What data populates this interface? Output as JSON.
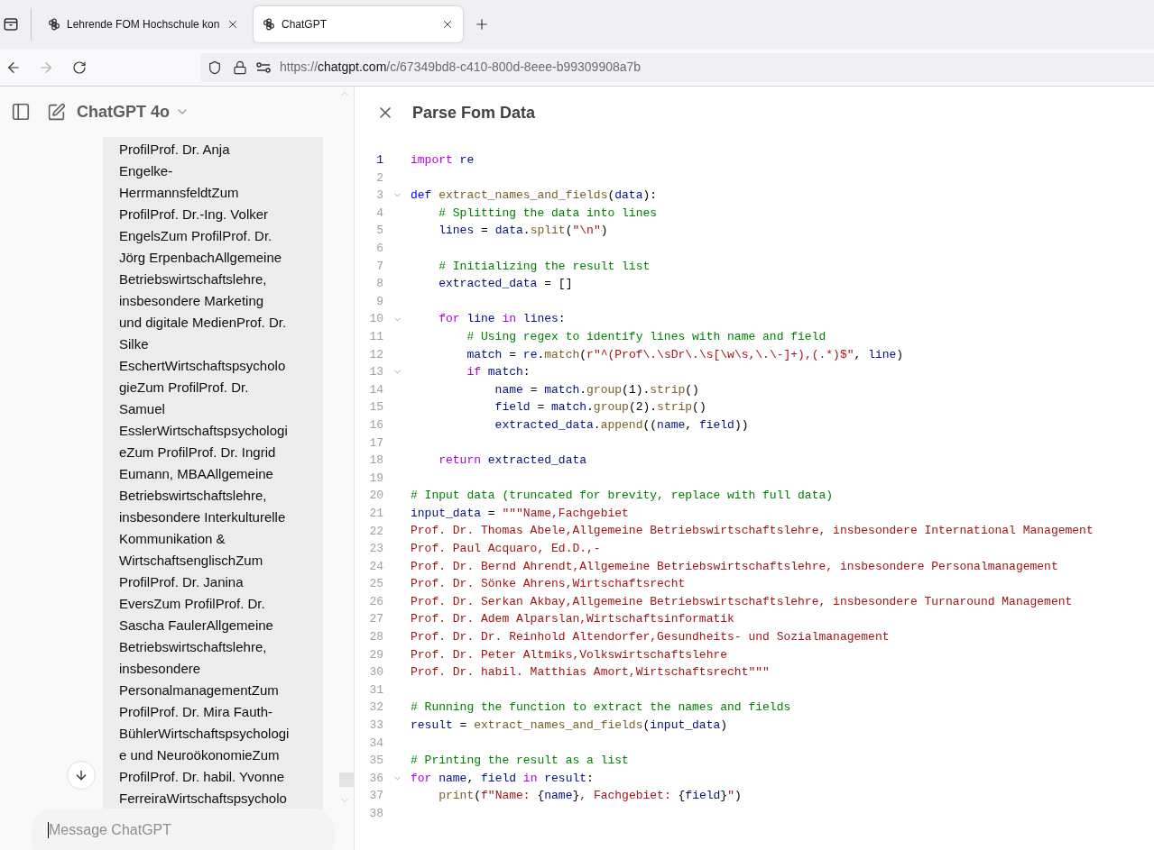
{
  "browser": {
    "tabs": [
      {
        "title": "Lehrende FOM Hochschule kon",
        "selected": false
      },
      {
        "title": "ChatGPT",
        "selected": true
      }
    ],
    "url": {
      "scheme": "https://",
      "host": "chatgpt.com",
      "path": "/c/67349bd8-c410-800d-8eee-b99309908a7b"
    },
    "forward_disabled": true
  },
  "sidebar": {
    "model": "ChatGPT 4o"
  },
  "chat": {
    "message_lines": [
      "ProfilProf. Dr. Anja",
      "Engelke-",
      "HerrmannsfeldtZum",
      "ProfilProf. Dr.-Ing. Volker",
      "EngelsZum ProfilProf. Dr.",
      "Jörg ErpenbachAllgemeine",
      "Betriebswirtschaftslehre,",
      "insbesondere Marketing",
      "und digitale MedienProf. Dr.",
      "Silke",
      "EschertWirtschaftspsycholo",
      "gieZum ProfilProf. Dr.",
      "Samuel",
      "EsslerWirtschaftspsychologi",
      "eZum ProfilProf. Dr. Ingrid",
      "Eumann, MBAAllgemeine",
      "Betriebswirtschaftslehre,",
      "insbesondere Interkulturelle",
      "Kommunikation &",
      "WirtschaftsenglischZum",
      "ProfilProf. Dr. Janina",
      "EversZum ProfilProf. Dr.",
      "Sascha FaulerAllgemeine",
      "Betriebswirtschaftslehre,",
      "insbesondere",
      "PersonalmanagementZum",
      "ProfilProf. Dr. Mira Fauth-",
      "BühlerWirtschaftspsychologi",
      "e und NeuroökonomieZum",
      "ProfilProf. Dr. habil. Yvonne",
      "FerreiraWirtschaftspsycholo"
    ],
    "input": {
      "placeholder": "Message ChatGPT"
    }
  },
  "canvas": {
    "title": "Parse Fom Data",
    "lines": [
      {
        "number": "1",
        "active": true,
        "foldable": false,
        "tokens": [
          {
            "kind": "keyword",
            "text": "import"
          },
          {
            "kind": "name",
            "text": " re"
          }
        ]
      },
      {
        "number": "2",
        "active": false,
        "foldable": false
      },
      {
        "number": "3",
        "active": false,
        "foldable": true,
        "tokens": [
          {
            "kind": "def",
            "text": "def"
          },
          {
            "kind": "function",
            "text": " extract_names_and_fields"
          },
          {
            "kind": "plain",
            "text": "("
          },
          {
            "kind": "name",
            "text": "data"
          },
          {
            "kind": "plain",
            "text": "):"
          }
        ]
      },
      {
        "number": "4",
        "active": false,
        "foldable": false,
        "tokens": [
          {
            "kind": "comment",
            "text": "    # Splitting the data into lines"
          }
        ]
      },
      {
        "number": "5",
        "active": false,
        "foldable": false,
        "tokens": [
          {
            "kind": "name",
            "text": "    lines"
          },
          {
            "kind": "plain",
            "text": " = "
          },
          {
            "kind": "name",
            "text": "data"
          },
          {
            "kind": "plain",
            "text": "."
          },
          {
            "kind": "function",
            "text": "split"
          },
          {
            "kind": "plain",
            "text": "("
          },
          {
            "kind": "string",
            "text": "\"\\n\""
          },
          {
            "kind": "plain",
            "text": ")"
          }
        ]
      },
      {
        "number": "6",
        "active": false,
        "foldable": false
      },
      {
        "number": "7",
        "active": false,
        "foldable": false,
        "tokens": [
          {
            "kind": "comment",
            "text": "    # Initializing the result list"
          }
        ]
      },
      {
        "number": "8",
        "active": false,
        "foldable": false,
        "tokens": [
          {
            "kind": "name",
            "text": "    extracted_data"
          },
          {
            "kind": "plain",
            "text": " = []"
          }
        ]
      },
      {
        "number": "9",
        "active": false,
        "foldable": false
      },
      {
        "number": "10",
        "active": false,
        "foldable": true,
        "tokens": [
          {
            "kind": "keyword",
            "text": "    for"
          },
          {
            "kind": "name",
            "text": " line"
          },
          {
            "kind": "keyword",
            "text": " in"
          },
          {
            "kind": "name",
            "text": " lines"
          },
          {
            "kind": "plain",
            "text": ":"
          }
        ]
      },
      {
        "number": "11",
        "active": false,
        "foldable": false,
        "tokens": [
          {
            "kind": "comment",
            "text": "        # Using regex to identify lines with name and field"
          }
        ]
      },
      {
        "number": "12",
        "active": false,
        "foldable": false,
        "tokens": [
          {
            "kind": "name",
            "text": "        match"
          },
          {
            "kind": "plain",
            "text": " = "
          },
          {
            "kind": "name",
            "text": "re"
          },
          {
            "kind": "plain",
            "text": "."
          },
          {
            "kind": "function",
            "text": "match"
          },
          {
            "kind": "plain",
            "text": "("
          },
          {
            "kind": "string",
            "text": "r\"^(Prof\\.\\sDr\\.\\s[\\w\\s,\\.\\-]+),(.*)$\""
          },
          {
            "kind": "plain",
            "text": ", "
          },
          {
            "kind": "name",
            "text": "line"
          },
          {
            "kind": "plain",
            "text": ")"
          }
        ]
      },
      {
        "number": "13",
        "active": false,
        "foldable": true,
        "tokens": [
          {
            "kind": "keyword",
            "text": "        if"
          },
          {
            "kind": "name",
            "text": " match"
          },
          {
            "kind": "plain",
            "text": ":"
          }
        ]
      },
      {
        "number": "14",
        "active": false,
        "foldable": false,
        "tokens": [
          {
            "kind": "name",
            "text": "            name"
          },
          {
            "kind": "plain",
            "text": " = "
          },
          {
            "kind": "name",
            "text": "match"
          },
          {
            "kind": "plain",
            "text": "."
          },
          {
            "kind": "function",
            "text": "group"
          },
          {
            "kind": "plain",
            "text": "(1)."
          },
          {
            "kind": "function",
            "text": "strip"
          },
          {
            "kind": "plain",
            "text": "()"
          }
        ]
      },
      {
        "number": "15",
        "active": false,
        "foldable": false,
        "tokens": [
          {
            "kind": "name",
            "text": "            field"
          },
          {
            "kind": "plain",
            "text": " = "
          },
          {
            "kind": "name",
            "text": "match"
          },
          {
            "kind": "plain",
            "text": "."
          },
          {
            "kind": "function",
            "text": "group"
          },
          {
            "kind": "plain",
            "text": "(2)."
          },
          {
            "kind": "function",
            "text": "strip"
          },
          {
            "kind": "plain",
            "text": "()"
          }
        ]
      },
      {
        "number": "16",
        "active": false,
        "foldable": false,
        "tokens": [
          {
            "kind": "name",
            "text": "            extracted_data"
          },
          {
            "kind": "plain",
            "text": "."
          },
          {
            "kind": "function",
            "text": "append"
          },
          {
            "kind": "plain",
            "text": "(("
          },
          {
            "kind": "name",
            "text": "name"
          },
          {
            "kind": "plain",
            "text": ", "
          },
          {
            "kind": "name",
            "text": "field"
          },
          {
            "kind": "plain",
            "text": "))"
          }
        ]
      },
      {
        "number": "17",
        "active": false,
        "foldable": false
      },
      {
        "number": "18",
        "active": false,
        "foldable": false,
        "tokens": [
          {
            "kind": "keyword",
            "text": "    return"
          },
          {
            "kind": "name",
            "text": " extracted_data"
          }
        ]
      },
      {
        "number": "19",
        "active": false,
        "foldable": false
      },
      {
        "number": "20",
        "active": false,
        "foldable": false,
        "tokens": [
          {
            "kind": "comment",
            "text": "# Input data (truncated for brevity, replace with full data)"
          }
        ]
      },
      {
        "number": "21",
        "active": false,
        "foldable": false,
        "tokens": [
          {
            "kind": "name",
            "text": "input_data"
          },
          {
            "kind": "plain",
            "text": " = "
          },
          {
            "kind": "string",
            "text": "\"\"\"Name,Fachgebiet"
          }
        ]
      },
      {
        "number": "22",
        "active": false,
        "foldable": false,
        "tokens": [
          {
            "kind": "string",
            "text": "Prof. Dr. Thomas Abele,Allgemeine Betriebswirtschaftslehre, insbesondere International Management"
          }
        ]
      },
      {
        "number": "23",
        "active": false,
        "foldable": false,
        "tokens": [
          {
            "kind": "string",
            "text": "Prof. Paul Acquaro, Ed.D.,-"
          }
        ]
      },
      {
        "number": "24",
        "active": false,
        "foldable": false,
        "tokens": [
          {
            "kind": "string",
            "text": "Prof. Dr. Bernd Ahrendt,Allgemeine Betriebswirtschaftslehre, insbesondere Personalmanagement"
          }
        ]
      },
      {
        "number": "25",
        "active": false,
        "foldable": false,
        "tokens": [
          {
            "kind": "string",
            "text": "Prof. Dr. Sönke Ahrens,Wirtschaftsrecht"
          }
        ]
      },
      {
        "number": "26",
        "active": false,
        "foldable": false,
        "tokens": [
          {
            "kind": "string",
            "text": "Prof. Dr. Serkan Akbay,Allgemeine Betriebswirtschaftslehre, insbesondere Turnaround Management"
          }
        ]
      },
      {
        "number": "27",
        "active": false,
        "foldable": false,
        "tokens": [
          {
            "kind": "string",
            "text": "Prof. Dr. Adem Alparslan,Wirtschaftsinformatik"
          }
        ]
      },
      {
        "number": "28",
        "active": false,
        "foldable": false,
        "tokens": [
          {
            "kind": "string",
            "text": "Prof. Dr. Dr. Reinhold Altendorfer,Gesundheits- und Sozialmanagement"
          }
        ]
      },
      {
        "number": "29",
        "active": false,
        "foldable": false,
        "tokens": [
          {
            "kind": "string",
            "text": "Prof. Dr. Peter Altmiks,Volkswirtschaftslehre"
          }
        ]
      },
      {
        "number": "30",
        "active": false,
        "foldable": false,
        "tokens": [
          {
            "kind": "string",
            "text": "Prof. Dr. habil. Matthias Amort,Wirtschaftsrecht\"\"\""
          }
        ]
      },
      {
        "number": "31",
        "active": false,
        "foldable": false
      },
      {
        "number": "32",
        "active": false,
        "foldable": false,
        "tokens": [
          {
            "kind": "comment",
            "text": "# Running the function to extract the names and fields"
          }
        ]
      },
      {
        "number": "33",
        "active": false,
        "foldable": false,
        "tokens": [
          {
            "kind": "name",
            "text": "result"
          },
          {
            "kind": "plain",
            "text": " = "
          },
          {
            "kind": "function",
            "text": "extract_names_and_fields"
          },
          {
            "kind": "plain",
            "text": "("
          },
          {
            "kind": "name",
            "text": "input_data"
          },
          {
            "kind": "plain",
            "text": ")"
          }
        ]
      },
      {
        "number": "34",
        "active": false,
        "foldable": false
      },
      {
        "number": "35",
        "active": false,
        "foldable": false,
        "tokens": [
          {
            "kind": "comment",
            "text": "# Printing the result as a list"
          }
        ]
      },
      {
        "number": "36",
        "active": false,
        "foldable": true,
        "tokens": [
          {
            "kind": "keyword",
            "text": "for"
          },
          {
            "kind": "name",
            "text": " name"
          },
          {
            "kind": "plain",
            "text": ", "
          },
          {
            "kind": "name",
            "text": "field"
          },
          {
            "kind": "keyword",
            "text": " in"
          },
          {
            "kind": "name",
            "text": " result"
          },
          {
            "kind": "plain",
            "text": ":"
          }
        ]
      },
      {
        "number": "37",
        "active": false,
        "foldable": false,
        "tokens": [
          {
            "kind": "function",
            "text": "    print"
          },
          {
            "kind": "plain",
            "text": "("
          },
          {
            "kind": "string",
            "text": "f\"Name: "
          },
          {
            "kind": "plain",
            "text": "{"
          },
          {
            "kind": "name",
            "text": "name"
          },
          {
            "kind": "plain",
            "text": "}"
          },
          {
            "kind": "string",
            "text": ", Fachgebiet: "
          },
          {
            "kind": "plain",
            "text": "{"
          },
          {
            "kind": "name",
            "text": "field"
          },
          {
            "kind": "plain",
            "text": "}"
          },
          {
            "kind": "string",
            "text": "\""
          },
          {
            "kind": "plain",
            "text": ")"
          }
        ]
      },
      {
        "number": "38",
        "active": false,
        "foldable": false
      }
    ]
  }
}
